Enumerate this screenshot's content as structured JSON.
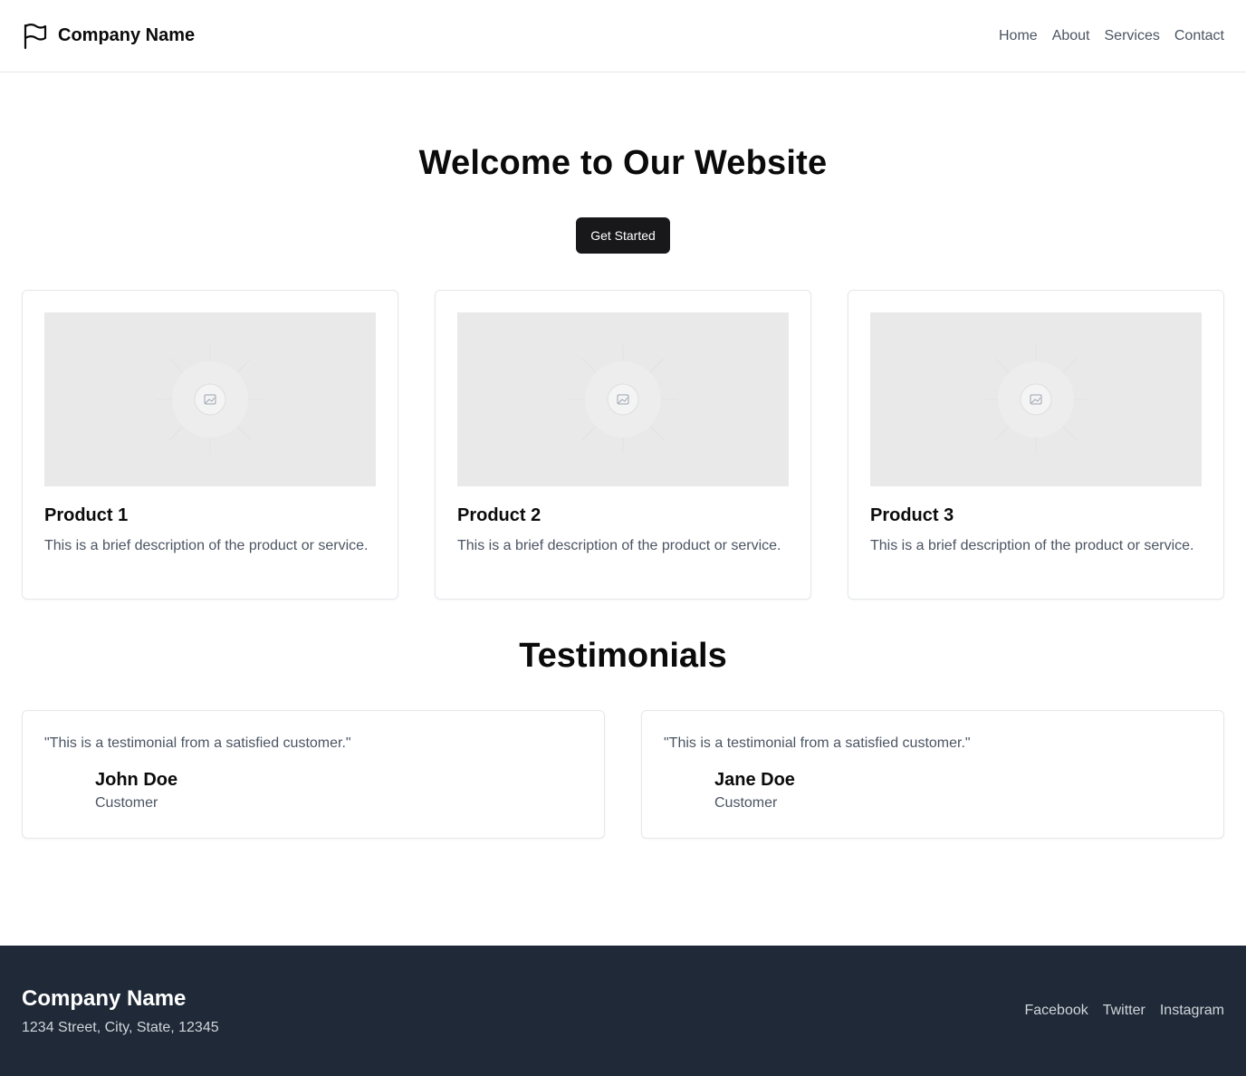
{
  "header": {
    "brand_name": "Company Name",
    "nav": [
      "Home",
      "About",
      "Services",
      "Contact"
    ]
  },
  "hero": {
    "title": "Welcome to Our Website",
    "cta_label": "Get Started"
  },
  "products": [
    {
      "title": "Product 1",
      "description": "This is a brief description of the product or service."
    },
    {
      "title": "Product 2",
      "description": "This is a brief description of the product or service."
    },
    {
      "title": "Product 3",
      "description": "This is a brief description of the product or service."
    }
  ],
  "testimonials": {
    "title": "Testimonials",
    "items": [
      {
        "quote": "\"This is a testimonial from a satisfied customer.\"",
        "name": "John Doe",
        "role": "Customer"
      },
      {
        "quote": "\"This is a testimonial from a satisfied customer.\"",
        "name": "Jane Doe",
        "role": "Customer"
      }
    ]
  },
  "footer": {
    "company_name": "Company Name",
    "address": "1234 Street, City, State, 12345",
    "social": [
      "Facebook",
      "Twitter",
      "Instagram"
    ]
  },
  "colors": {
    "footer_bg": "#1f2937",
    "cta_bg": "#18181b",
    "placeholder_bg": "#e9e9e9"
  }
}
